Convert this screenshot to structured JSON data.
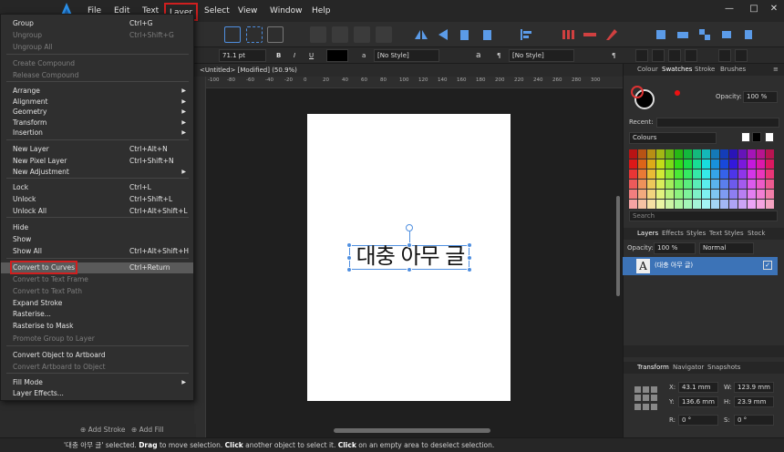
{
  "menubar": {
    "items": [
      "File",
      "Edit",
      "Text",
      "Layer",
      "Select",
      "View",
      "Window",
      "Help"
    ],
    "active": "Layer"
  },
  "context_bar": {
    "font_size": "71.1 pt",
    "bold": "B",
    "italic": "I",
    "underline": "U",
    "char_style": "[No Style]",
    "para_style": "[No Style]",
    "a_glyph": "a",
    "pilcrow": "¶"
  },
  "document": {
    "tab_label": "<Untitled> [Modified] (50.9%)",
    "text": "대충 아무 글"
  },
  "ruler": {
    "h_ticks": [
      "-100",
      "-80",
      "-60",
      "-40",
      "-20",
      "0",
      "20",
      "40",
      "60",
      "80",
      "100",
      "120",
      "140",
      "160",
      "180",
      "200",
      "220",
      "240",
      "260",
      "280",
      "300"
    ]
  },
  "layer_menu": {
    "items": [
      {
        "label": "Group",
        "shortcut": "Ctrl+G",
        "disabled": false
      },
      {
        "label": "Ungroup",
        "shortcut": "Ctrl+Shift+G",
        "disabled": true
      },
      {
        "label": "Ungroup All",
        "shortcut": "",
        "disabled": true
      },
      {
        "label": "Create Compound",
        "shortcut": "",
        "disabled": true
      },
      {
        "label": "Release Compound",
        "shortcut": "",
        "disabled": true
      },
      {
        "label": "Arrange",
        "shortcut": "",
        "disabled": false,
        "submenu": true
      },
      {
        "label": "Alignment",
        "shortcut": "",
        "disabled": false,
        "submenu": true
      },
      {
        "label": "Geometry",
        "shortcut": "",
        "disabled": false,
        "submenu": true
      },
      {
        "label": "Transform",
        "shortcut": "",
        "disabled": false,
        "submenu": true
      },
      {
        "label": "Insertion",
        "shortcut": "",
        "disabled": false,
        "submenu": true
      },
      {
        "label": "New Layer",
        "shortcut": "Ctrl+Alt+N",
        "disabled": false
      },
      {
        "label": "New Pixel Layer",
        "shortcut": "Ctrl+Shift+N",
        "disabled": false
      },
      {
        "label": "New Adjustment",
        "shortcut": "",
        "disabled": false,
        "submenu": true
      },
      {
        "label": "Lock",
        "shortcut": "Ctrl+L",
        "disabled": false
      },
      {
        "label": "Unlock",
        "shortcut": "Ctrl+Shift+L",
        "disabled": false
      },
      {
        "label": "Unlock All",
        "shortcut": "Ctrl+Alt+Shift+L",
        "disabled": false
      },
      {
        "label": "Hide",
        "shortcut": "",
        "disabled": false
      },
      {
        "label": "Show",
        "shortcut": "",
        "disabled": false
      },
      {
        "label": "Show All",
        "shortcut": "Ctrl+Alt+Shift+H",
        "disabled": false
      },
      {
        "label": "Convert to Curves",
        "shortcut": "Ctrl+Return",
        "disabled": false,
        "highlighted": true
      },
      {
        "label": "Convert to Text Frame",
        "shortcut": "",
        "disabled": true
      },
      {
        "label": "Convert to Text Path",
        "shortcut": "",
        "disabled": true
      },
      {
        "label": "Expand Stroke",
        "shortcut": "",
        "disabled": false
      },
      {
        "label": "Rasterise...",
        "shortcut": "",
        "disabled": false
      },
      {
        "label": "Rasterise to Mask",
        "shortcut": "",
        "disabled": false
      },
      {
        "label": "Promote Group to Layer",
        "shortcut": "",
        "disabled": true
      },
      {
        "label": "Convert Object to Artboard",
        "shortcut": "",
        "disabled": false
      },
      {
        "label": "Convert Artboard to Object",
        "shortcut": "",
        "disabled": true
      },
      {
        "label": "Fill Mode",
        "shortcut": "",
        "disabled": false,
        "submenu": true
      },
      {
        "label": "Layer Effects...",
        "shortcut": "",
        "disabled": false
      }
    ]
  },
  "bottom_strip": {
    "add_stroke": "Add Stroke",
    "add_fill": "Add Fill"
  },
  "status": {
    "selected": "'대충 아무 글' selected. ",
    "drag": "Drag",
    "drag_rest": " to move selection. ",
    "click1": "Click",
    "click1_rest": " another object to select it. ",
    "click2": "Click",
    "click2_rest": " on an empty area to deselect selection."
  },
  "right_panel": {
    "colour_tabs": [
      "Colour",
      "Swatches",
      "Stroke",
      "Brushes"
    ],
    "colour_active": "Swatches",
    "opacity_label": "Opacity:",
    "opacity_value": "100 %",
    "recent_label": "Recent:",
    "palette_name": "Colours",
    "search_placeholder": "Search",
    "layers_tabs": [
      "Layers",
      "Effects",
      "Styles",
      "Text Styles",
      "Stock"
    ],
    "layers_active": "Layers",
    "layer_opacity_label": "Opacity:",
    "layer_opacity_value": "100 %",
    "blend_mode": "Normal",
    "layer_name": "(대충 아무 글)",
    "layer_thumb": "A",
    "transform_tabs": [
      "Transform",
      "Navigator",
      "Snapshots"
    ],
    "transform_active": "Transform",
    "x_label": "X:",
    "x_value": "43.1 mm",
    "y_label": "Y:",
    "y_value": "136.6 mm",
    "w_label": "W:",
    "w_value": "123.9 mm",
    "h_label": "H:",
    "h_value": "23.9 mm",
    "r_label": "R:",
    "r_value": "0 °",
    "s_label": "S:",
    "s_value": "0 °"
  },
  "colors": {
    "accent": "#3c73b7",
    "highlight_border": "#d01f1f",
    "selection": "#4f8fe0"
  }
}
